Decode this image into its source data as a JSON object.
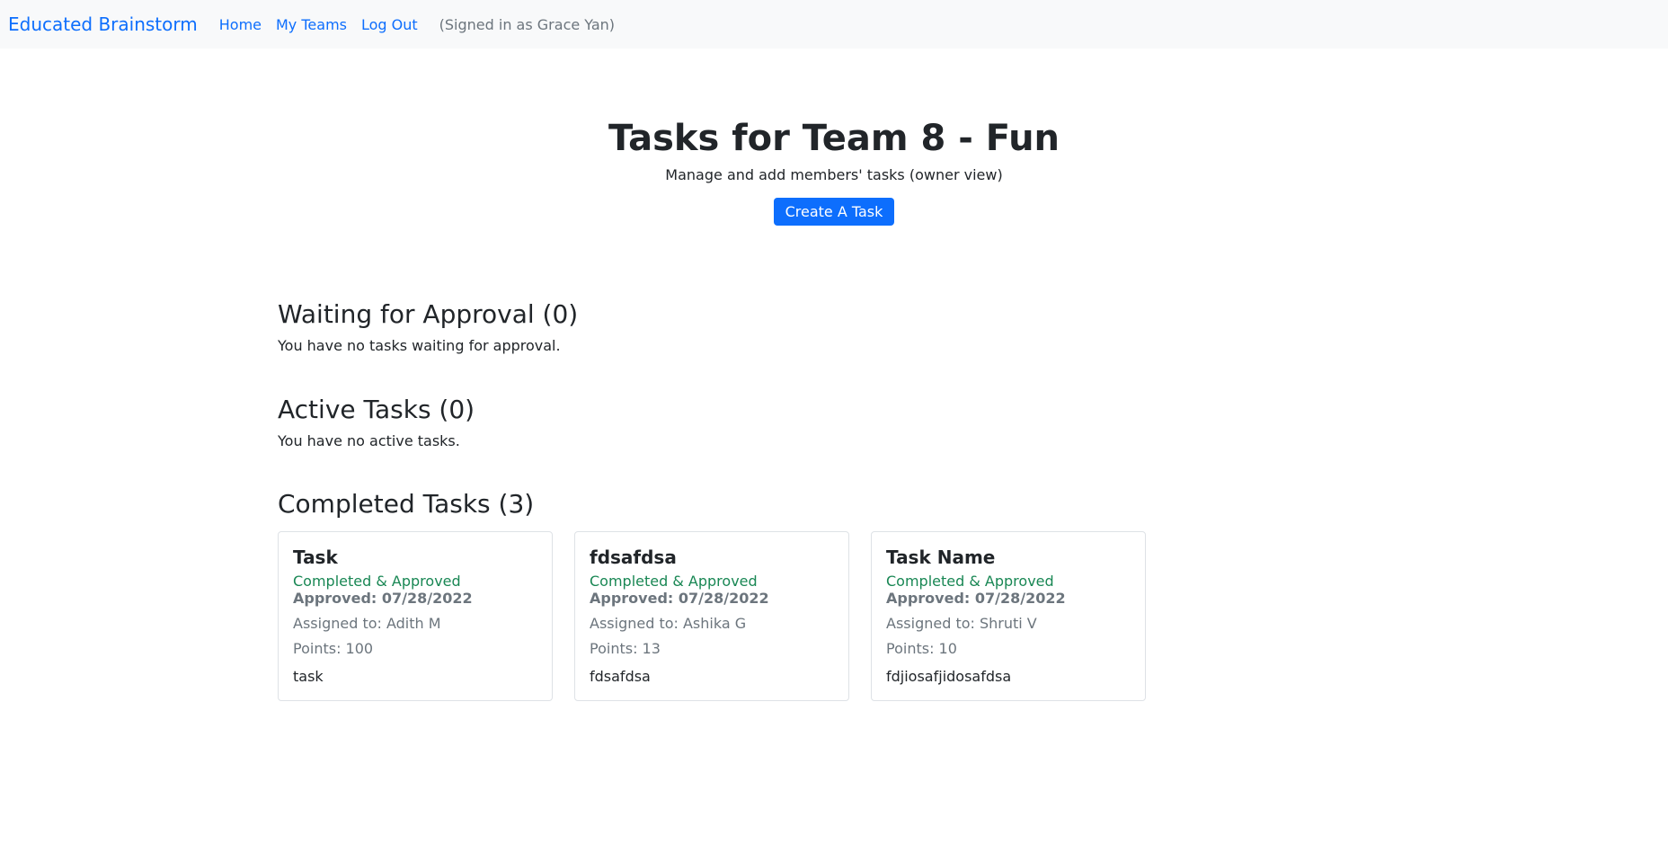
{
  "nav": {
    "brand": "Educated Brainstorm",
    "links": [
      "Home",
      "My Teams",
      "Log Out"
    ],
    "signed_in": "(Signed in as Grace Yan)"
  },
  "header": {
    "title": "Tasks for Team 8 - Fun",
    "subtitle": "Manage and add members' tasks (owner view)",
    "create_button": "Create A Task"
  },
  "sections": {
    "waiting": {
      "title": "Waiting for Approval (0)",
      "text": "You have no tasks waiting for approval."
    },
    "active": {
      "title": "Active Tasks (0)",
      "text": "You have no active tasks."
    },
    "completed": {
      "title": "Completed Tasks (3)"
    }
  },
  "cards": [
    {
      "title": "Task",
      "status": "Completed & Approved",
      "approved": "Approved: 07/28/2022",
      "assigned": "Assigned to: Adith M",
      "points": "Points: 100",
      "description": "task"
    },
    {
      "title": "fdsafdsa",
      "status": "Completed & Approved",
      "approved": "Approved: 07/28/2022",
      "assigned": "Assigned to: Ashika G",
      "points": "Points: 13",
      "description": "fdsafdsa"
    },
    {
      "title": "Task Name",
      "status": "Completed & Approved",
      "approved": "Approved: 07/28/2022",
      "assigned": "Assigned to: Shruti V",
      "points": "Points: 10",
      "description": "fdjiosafjidosafdsa"
    }
  ],
  "colors": {
    "primary": "#0d6efd",
    "success": "#198754",
    "muted": "#6c757d",
    "navbar_bg": "#f8f9fa"
  }
}
